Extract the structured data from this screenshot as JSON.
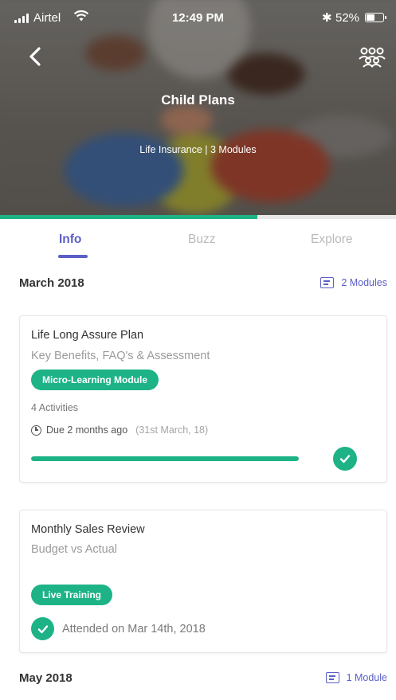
{
  "status_bar": {
    "carrier": "Airtel",
    "time": "12:49 PM",
    "battery": "52%",
    "battery_level": 0.52,
    "icons": [
      "signal-icon",
      "wifi-icon",
      "bluetooth-icon",
      "battery-icon"
    ]
  },
  "header": {
    "title": "Child Plans",
    "subtitle": "Life Insurance | 3 Modules",
    "back_icon": "chevron-left-icon",
    "group_icon": "group-icon",
    "progress": 0.65
  },
  "tabs": [
    {
      "label": "Info",
      "active": true
    },
    {
      "label": "Buzz",
      "active": false
    },
    {
      "label": "Explore",
      "active": false
    }
  ],
  "sections": [
    {
      "title": "March 2018",
      "count_label": "2 Modules",
      "cards": [
        {
          "title": "Life Long Assure Plan",
          "subtitle": "Key Benefits, FAQ's & Assessment",
          "badge": "Micro-Learning Module",
          "activities": "4 Activities",
          "due": "Due 2 months ago",
          "due_date": "(31st March, 18)",
          "progress": 1.0,
          "completed": true
        },
        {
          "title": "Monthly Sales Review",
          "subtitle": "Budget vs Actual",
          "badge": "Live Training",
          "attended": "Attended on Mar 14th, 2018",
          "completed": true
        }
      ]
    },
    {
      "title": "May 2018",
      "count_label": "1 Module"
    }
  ],
  "colors": {
    "accent": "#5b5fc7",
    "success": "#1db386",
    "muted": "#9b9b9b"
  }
}
